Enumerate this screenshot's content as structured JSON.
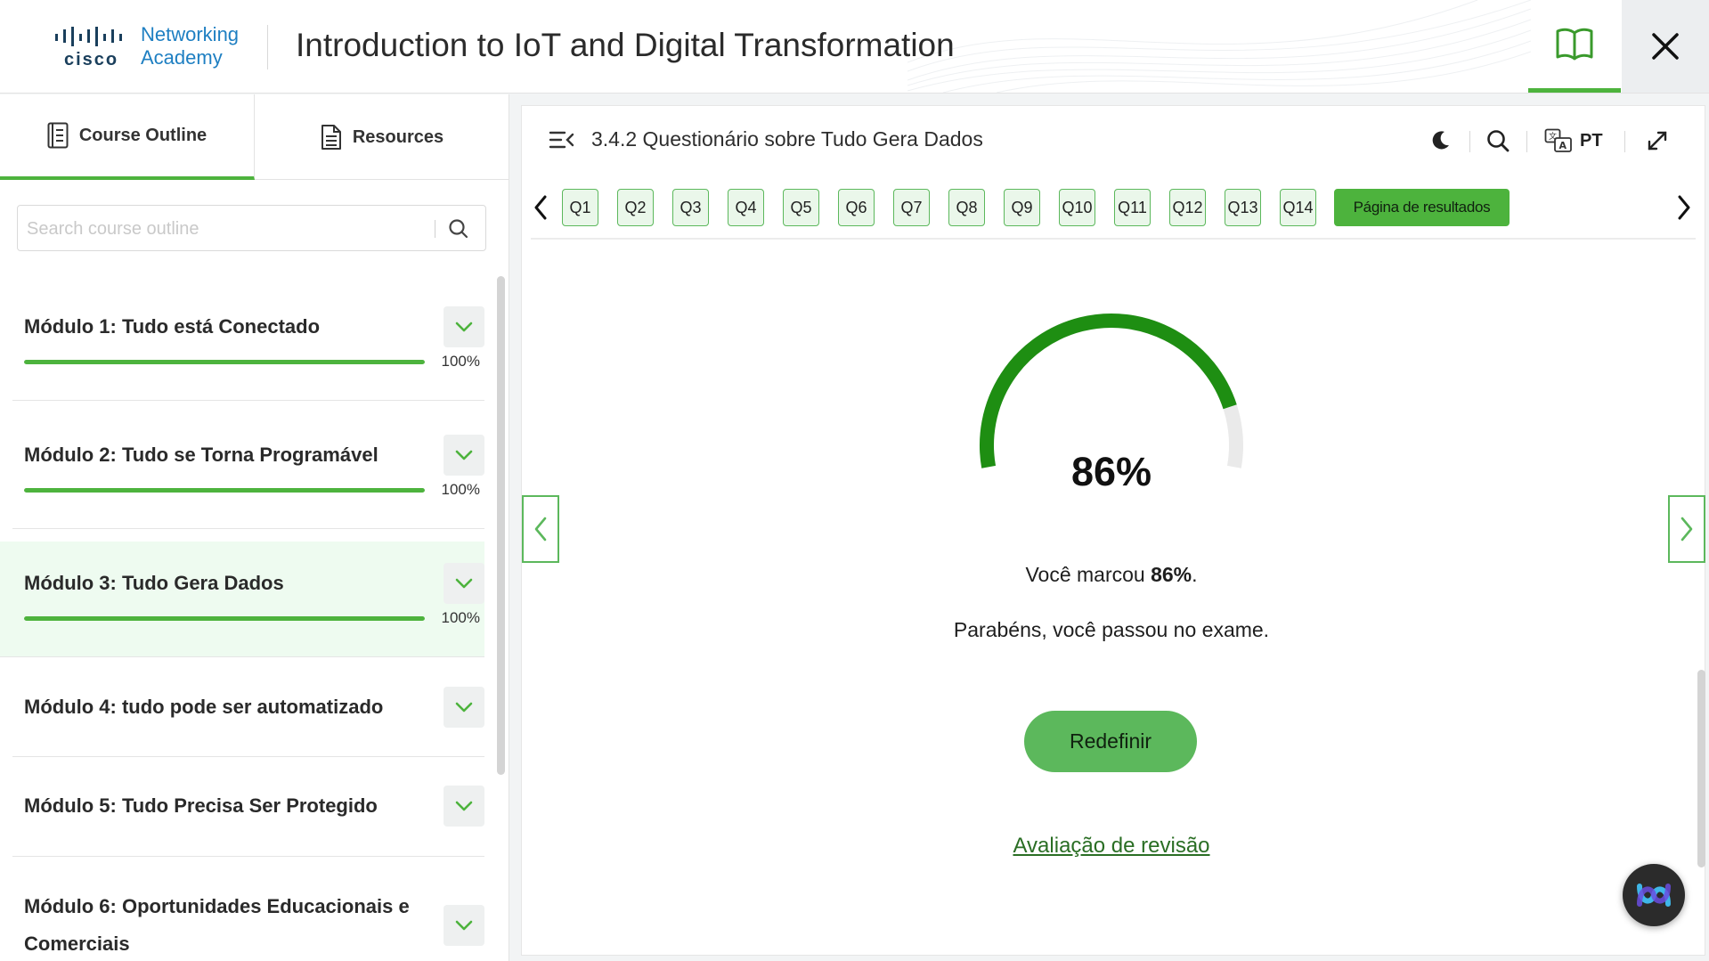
{
  "header": {
    "logo": {
      "cisco": "cisco",
      "line1": "Networking",
      "line2": "Academy"
    },
    "course_title": "Introduction to IoT and Digital Transformation"
  },
  "sidebar": {
    "tabs": [
      {
        "label": "Course Outline",
        "icon": "outline-icon",
        "active": true
      },
      {
        "label": "Resources",
        "icon": "document-icon",
        "active": false
      }
    ],
    "search": {
      "placeholder": "Search course outline",
      "value": ""
    },
    "modules": [
      {
        "title": "Módulo 1: Tudo está Conectado",
        "progress": "100%",
        "progress_value": 100,
        "active": false
      },
      {
        "title": "Módulo 2: Tudo se Torna Programável",
        "progress": "100%",
        "progress_value": 100,
        "active": false
      },
      {
        "title": "Módulo 3: Tudo Gera Dados",
        "progress": "100%",
        "progress_value": 100,
        "active": true
      },
      {
        "title": "Módulo 4: tudo pode ser automatizado",
        "active": false
      },
      {
        "title": "Módulo 5: Tudo Precisa Ser Protegido",
        "active": false
      },
      {
        "title": "Módulo 6: Oportunidades Educacionais e Comerciais",
        "active": false
      }
    ]
  },
  "content": {
    "page_title": "3.4.2 Questionário sobre Tudo Gera Dados",
    "language": "PT",
    "questions": [
      "Q1",
      "Q2",
      "Q3",
      "Q4",
      "Q5",
      "Q6",
      "Q7",
      "Q8",
      "Q9",
      "Q10",
      "Q11",
      "Q12",
      "Q13",
      "Q14"
    ],
    "results_label": "Página de resultados",
    "score_value": 86,
    "score_text": "86%",
    "marked_prefix": "Você marcou ",
    "marked_score": "86%",
    "marked_suffix": ".",
    "congrats": "Parabéns, você passou no exame.",
    "reset_label": "Redefinir",
    "review_label": "Avaliação de revisão"
  },
  "colors": {
    "accent": "#4db33d",
    "gauge_fill": "#1e8e12",
    "gauge_track": "#eaeaea",
    "link": "#2a6e24"
  }
}
